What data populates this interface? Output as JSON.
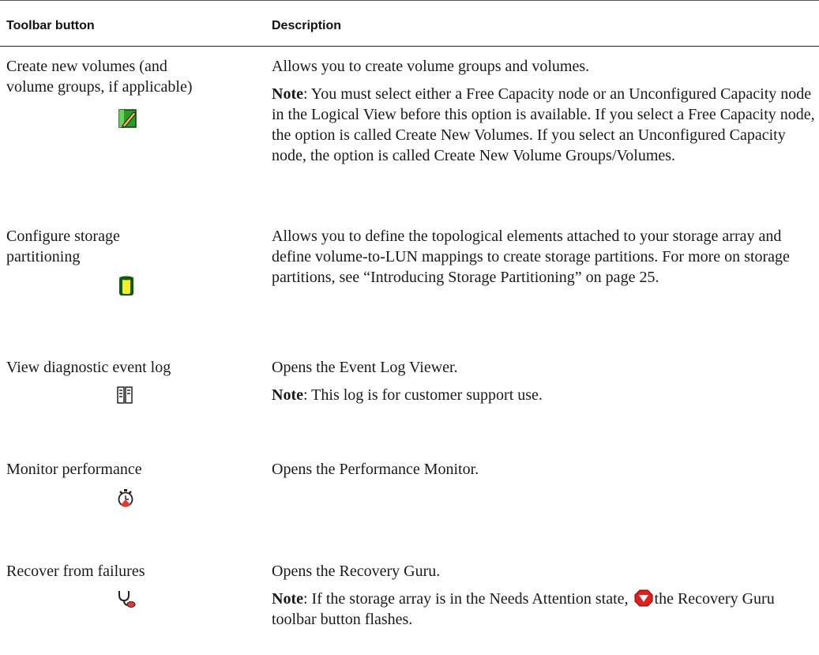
{
  "table": {
    "headers": {
      "button": "Toolbar button",
      "description": "Description"
    },
    "rows": [
      {
        "button_line1": "Create new volumes (and",
        "button_line2": "volume groups, if applicable)",
        "icon": "create-volume-icon",
        "description": "Allows you to create volume groups and volumes.",
        "note_label": "Note",
        "note_text": ": You must select either a Free Capacity node or an Unconfigured Capacity node in the Logical View before this option is available. If you select a Free Capacity node, the option is called Create New Volumes. If you select an Unconfigured Capacity node, the option is called Create New Volume Groups/Volumes."
      },
      {
        "button_line1": "Configure storage",
        "button_line2": "partitioning",
        "icon": "storage-partition-icon",
        "description": "Allows you to define the topological elements attached to your storage array and define volume-to-LUN mappings to create storage partitions. For more on storage partitions, see “Introducing Storage Partitioning” on page 25."
      },
      {
        "button_line1": "View diagnostic event log",
        "icon": "event-log-icon",
        "description": "Opens the Event Log Viewer.",
        "note_label": "Note",
        "note_text": ": This log is for customer support use."
      },
      {
        "button_line1": "Monitor performance",
        "icon": "stopwatch-icon",
        "description": "Opens the Performance Monitor."
      },
      {
        "button_line1": "Recover from failures",
        "icon": "stethoscope-icon",
        "description": "Opens the Recovery Guru.",
        "note_label": "Note",
        "note_text_before": ": If the storage array is in the Needs Attention state,",
        "inline_icon": "needs-attention-icon",
        "note_text_after": "the Recovery Guru toolbar button flashes."
      }
    ]
  }
}
